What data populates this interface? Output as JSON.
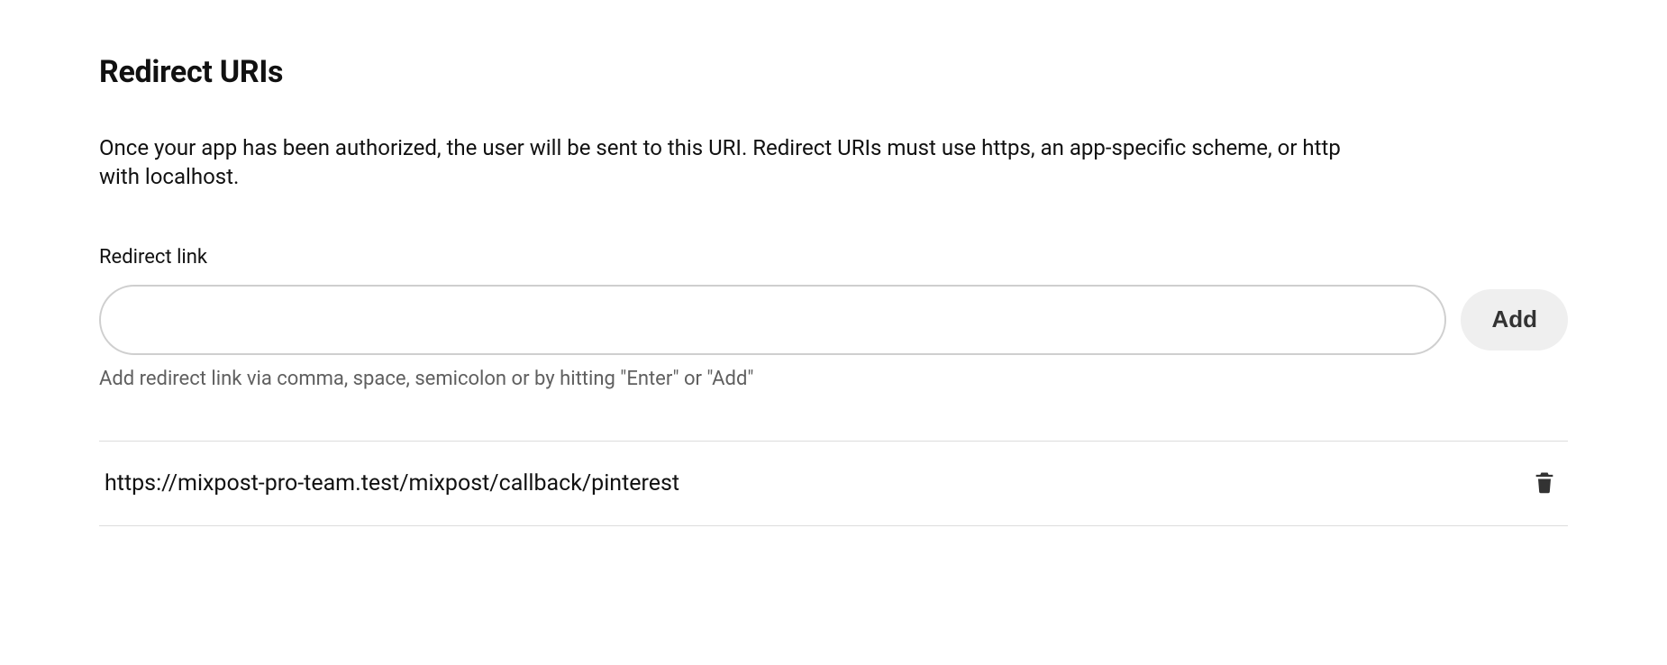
{
  "section": {
    "title": "Redirect URIs",
    "description": "Once your app has been authorized, the user will be sent to this URI. Redirect URIs must use https, an app-specific scheme, or http with localhost."
  },
  "form": {
    "label": "Redirect link",
    "input_value": "",
    "input_placeholder": "",
    "add_button_label": "Add",
    "helper_text": "Add redirect link via comma, space, semicolon or by hitting \"Enter\" or \"Add\""
  },
  "uris": [
    {
      "url": "https://mixpost-pro-team.test/mixpost/callback/pinterest"
    }
  ]
}
